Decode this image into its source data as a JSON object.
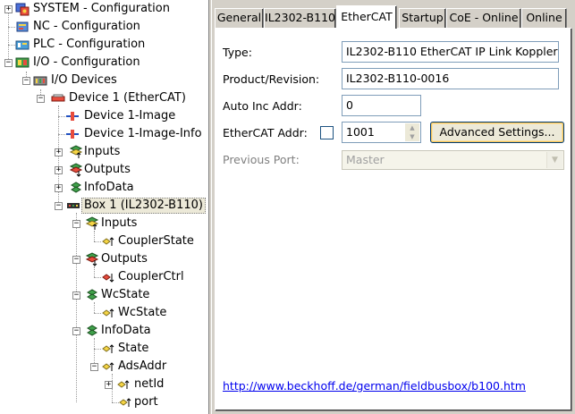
{
  "tree": {
    "items": [
      {
        "label": "SYSTEM - Configuration",
        "icon": "system-config-icon"
      },
      {
        "label": "NC - Configuration",
        "icon": "nc-config-icon"
      },
      {
        "label": "PLC - Configuration",
        "icon": "plc-config-icon"
      },
      {
        "label": "I/O - Configuration",
        "icon": "io-config-icon"
      },
      {
        "label": "I/O Devices",
        "icon": "io-devices-icon"
      },
      {
        "label": "Device 1 (EtherCAT)",
        "icon": "ethercat-device-icon"
      },
      {
        "label": "Device 1-Image",
        "icon": "device-image-icon"
      },
      {
        "label": "Device 1-Image-Info",
        "icon": "device-image-info-icon"
      },
      {
        "label": "Inputs",
        "icon": "inputs-icon"
      },
      {
        "label": "Outputs",
        "icon": "outputs-icon"
      },
      {
        "label": "InfoData",
        "icon": "infodata-icon"
      },
      {
        "label": "Box 1 (IL2302-B110)",
        "icon": "box-icon"
      },
      {
        "label": "Inputs",
        "icon": "inputs-icon"
      },
      {
        "label": "CouplerState",
        "icon": "input-var-icon"
      },
      {
        "label": "Outputs",
        "icon": "outputs-icon"
      },
      {
        "label": "CouplerCtrl",
        "icon": "output-var-icon"
      },
      {
        "label": "WcState",
        "icon": "infodata-icon"
      },
      {
        "label": "WcState",
        "icon": "input-var-icon"
      },
      {
        "label": "InfoData",
        "icon": "infodata-icon"
      },
      {
        "label": "State",
        "icon": "input-var-icon"
      },
      {
        "label": "AdsAddr",
        "icon": "input-var-icon"
      },
      {
        "label": "netId",
        "icon": "input-var-icon"
      },
      {
        "label": "port",
        "icon": "input-var-icon"
      }
    ]
  },
  "tabs": [
    {
      "label": "General"
    },
    {
      "label": "IL2302-B110"
    },
    {
      "label": "EtherCAT"
    },
    {
      "label": "Startup"
    },
    {
      "label": "CoE - Online"
    },
    {
      "label": "Online"
    }
  ],
  "form": {
    "type_label": "Type:",
    "type_value": "IL2302-B110 EtherCAT IP Link Koppler",
    "product_label": "Product/Revision:",
    "product_value": "IL2302-B110-0016",
    "autoinc_label": "Auto Inc Addr:",
    "autoinc_value": "0",
    "ethercat_label": "EtherCAT Addr:",
    "ethercat_value": "1001",
    "advanced_button": "Advanced Settings...",
    "prevport_label": "Previous Port:",
    "prevport_value": "Master",
    "link": "http://www.beckhoff.de/german/fieldbusbox/b100.htm"
  },
  "colors": {
    "selection": "#ece9d8",
    "link": "#0000ee",
    "panel_bg": "#d4d0c8"
  }
}
